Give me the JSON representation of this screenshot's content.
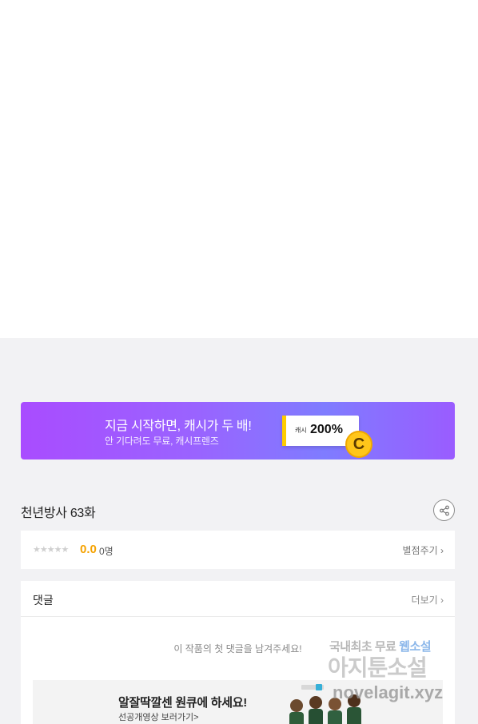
{
  "banner": {
    "headline": "지금 시작하면, 캐시가 두 배!",
    "subtext": "안 기다려도 무료, 캐시프렌즈",
    "card_label": "캐시",
    "card_value": "200%",
    "coin_letter": "C"
  },
  "episode": {
    "title": "천년방사 63화"
  },
  "rating": {
    "stars": "★★★★★",
    "value": "0.0",
    "count": "0명",
    "rate_label": "별점주기 ›"
  },
  "comments": {
    "title": "댓글",
    "more_label": "더보기 ›",
    "empty_message": "이 작품의 첫 댓글을 남겨주세요!"
  },
  "ad": {
    "headline": "알잘딱깔센 원큐에 하세요!",
    "subtext": "선공개영상 보러가기>"
  },
  "watermark": {
    "line1_prefix": "국내최초 무료 ",
    "line1_accent": "웹소설",
    "line2": "아지툰소설",
    "line3": "novelagit.xyz"
  },
  "colors": {
    "page_gray": "#f2f2f4",
    "rating_accent": "#f5a200",
    "banner_start": "#a94cff",
    "banner_end": "#7f7cff"
  }
}
